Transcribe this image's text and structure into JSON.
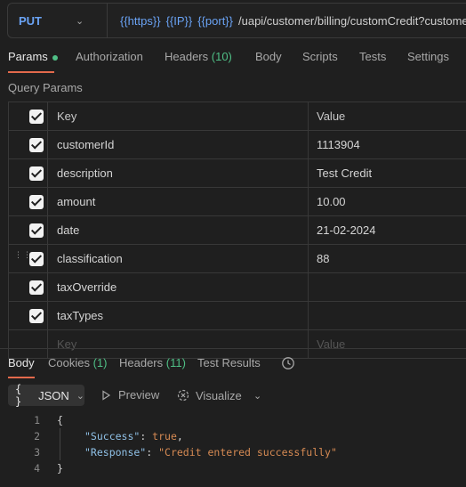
{
  "request": {
    "method": "PUT",
    "url_vars": [
      "{{https}}",
      "{{IP}}",
      "{{port}}"
    ],
    "url_path": "/uapi/customer/billing/customCredit?customer"
  },
  "tabs": [
    {
      "label": "Params",
      "count": ""
    },
    {
      "label": "Authorization",
      "count": ""
    },
    {
      "label": "Headers",
      "count": "(10)"
    },
    {
      "label": "Body",
      "count": ""
    },
    {
      "label": "Scripts",
      "count": ""
    },
    {
      "label": "Tests",
      "count": ""
    },
    {
      "label": "Settings",
      "count": ""
    }
  ],
  "query_params_title": "Query Params",
  "table": {
    "headers": {
      "key": "Key",
      "value": "Value"
    },
    "rows": [
      {
        "key": "customerId",
        "value": "1113904",
        "checked": true
      },
      {
        "key": "description",
        "value": "Test Credit",
        "checked": true
      },
      {
        "key": "amount",
        "value": "10.00",
        "checked": true
      },
      {
        "key": "date",
        "value": "21-02-2024",
        "checked": true
      },
      {
        "key": "classification",
        "value": "88",
        "checked": true
      },
      {
        "key": "taxOverride",
        "value": "",
        "checked": true
      },
      {
        "key": "taxTypes",
        "value": "",
        "checked": true
      }
    ],
    "placeholder": {
      "key": "Key",
      "value": "Value"
    }
  },
  "response_tabs": [
    {
      "label": "Body",
      "count": ""
    },
    {
      "label": "Cookies",
      "count": "(1)"
    },
    {
      "label": "Headers",
      "count": "(11)"
    },
    {
      "label": "Test Results",
      "count": ""
    }
  ],
  "toolbar": {
    "format": "JSON",
    "preview": "Preview",
    "visualize": "Visualize"
  },
  "code": {
    "line_numbers": [
      "1",
      "2",
      "3",
      "4"
    ],
    "open": "{",
    "close": "}",
    "key1": "\"Success\"",
    "val1": "true",
    "key2": "\"Response\"",
    "val2": "\"Credit entered successfully\""
  },
  "colors": {
    "accent": "#e36a4c",
    "count_green": "#4fbf86",
    "method_blue": "#6aa3f5"
  }
}
